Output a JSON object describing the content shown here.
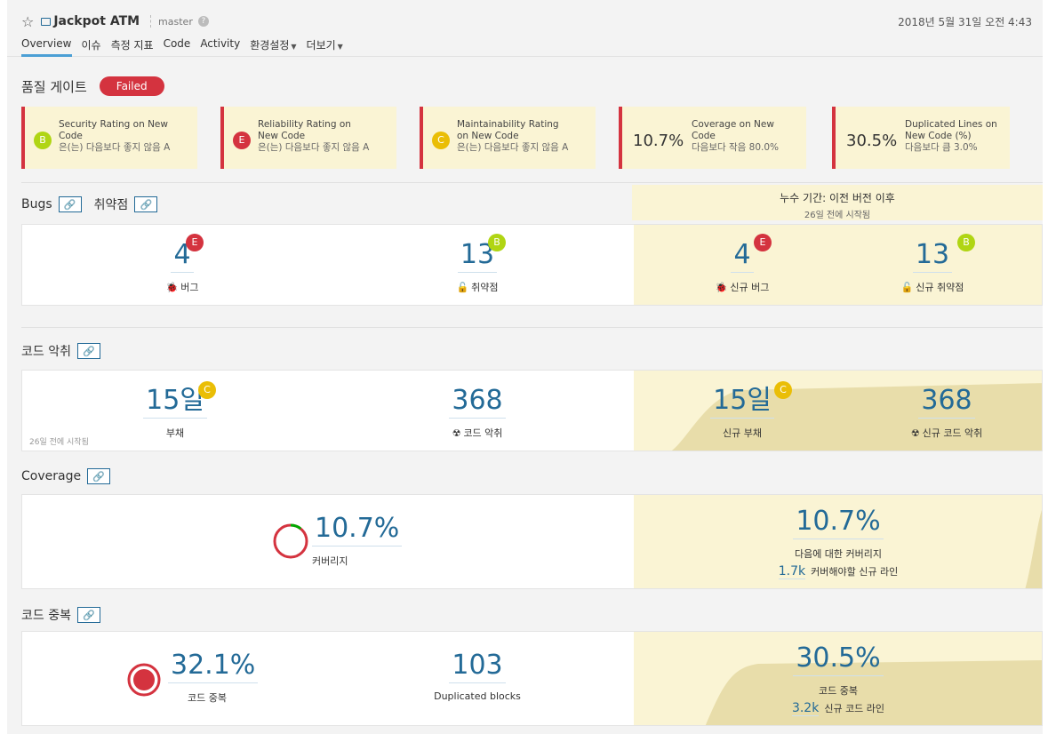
{
  "header": {
    "project_name": "Jackpot ATM",
    "branch": "master",
    "date": "2018년 5월 31일 오전 4:43",
    "nav": [
      "Overview",
      "이슈",
      "측정 지표",
      "Code",
      "Activity",
      "환경설정",
      "더보기"
    ]
  },
  "quality_gate": {
    "label": "품질 게이트",
    "status": "Failed",
    "conditions": [
      {
        "rating": "B",
        "line1": "Security Rating on New",
        "line2": "Code",
        "sub": "은(는) 다음보다 좋지 않음 A"
      },
      {
        "rating": "E",
        "line1": "Reliability Rating on",
        "line2": "New Code",
        "sub": "은(는) 다음보다 좋지 않음 A"
      },
      {
        "rating": "C",
        "line1": "Maintainability Rating",
        "line2": "on New Code",
        "sub": "은(는) 다음보다 좋지 않음 A"
      },
      {
        "value": "10.7%",
        "line1": "Coverage on New",
        "line2": "Code",
        "sub": "다음보다 작음 80.0%"
      },
      {
        "value": "30.5%",
        "line1": "Duplicated Lines on",
        "line2": "New Code (%)",
        "sub": "다음보다 큼 3.0%"
      }
    ]
  },
  "leak_period": {
    "title": "누수 기간: 이전 버전 이후",
    "started": "26일 전에 시작됨"
  },
  "bugs": {
    "title_bugs": "Bugs",
    "title_vuln": "취약점",
    "bugs_value": "4",
    "bugs_rating": "E",
    "bugs_label": "버그",
    "vuln_value": "13",
    "vuln_rating": "B",
    "vuln_label": "취약점",
    "new_bugs_value": "4",
    "new_bugs_rating": "E",
    "new_bugs_label": "신규 버그",
    "new_vuln_value": "13",
    "new_vuln_rating": "B",
    "new_vuln_label": "신규 취약점"
  },
  "smells": {
    "title": "코드 악취",
    "debt_value": "15일",
    "debt_rating": "C",
    "debt_label": "부채",
    "smells_value": "368",
    "smells_label": "코드 악취",
    "started": "26일 전에 시작됨",
    "new_debt_value": "15일",
    "new_debt_rating": "C",
    "new_debt_label": "신규 부채",
    "new_smells_value": "368",
    "new_smells_label": "신규 코드 악취"
  },
  "coverage": {
    "title": "Coverage",
    "value": "10.7%",
    "label": "커버리지",
    "new_value": "10.7%",
    "new_label": "다음에 대한 커버리지",
    "lines_value": "1.7k",
    "lines_label": "커버해야할 신규 라인"
  },
  "duplications": {
    "title": "코드 중복",
    "value": "32.1%",
    "label": "코드 중복",
    "blocks_value": "103",
    "blocks_label": "Duplicated blocks",
    "new_value": "30.5%",
    "new_label": "코드 중복",
    "lines_value": "3.2k",
    "lines_label": "신규 코드 라인"
  }
}
